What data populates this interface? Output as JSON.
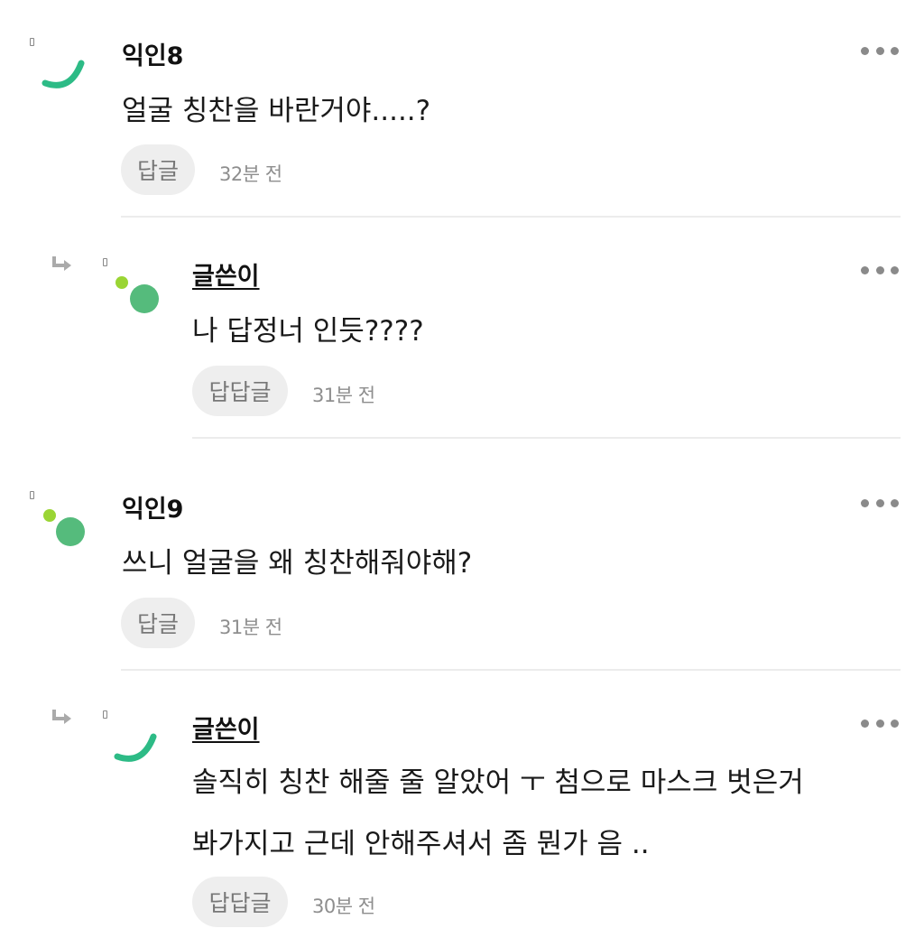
{
  "comments": [
    {
      "author": "익인8",
      "is_writer": false,
      "is_reply": false,
      "text_lines": [
        "얼굴 칭찬을 바란거야.....?"
      ],
      "reply_label": "답글",
      "time": "32분 전",
      "avatar": "green-arc",
      "more_icon": "more-dots-icon"
    },
    {
      "author": "글쓴이",
      "is_writer": true,
      "is_reply": true,
      "text_lines": [
        "나 답정너 인듯????"
      ],
      "reply_label": "답답글",
      "time": "31분 전",
      "avatar": "green-dots",
      "more_icon": "more-dots-icon"
    },
    {
      "author": "익인9",
      "is_writer": false,
      "is_reply": false,
      "text_lines": [
        "쓰니 얼굴을 왜 칭찬해줘야해?"
      ],
      "reply_label": "답글",
      "time": "31분 전",
      "avatar": "green-dots",
      "more_icon": "more-dots-icon"
    },
    {
      "author": "글쓴이",
      "is_writer": true,
      "is_reply": true,
      "text_lines": [
        "솔직히 칭찬 해줄 줄 알았어 ㅜ 첨으로 마스크 벗은거",
        "봐가지고 근데 안해주셔서 좀 뭔가 음 .."
      ],
      "reply_label": "답답글",
      "time": "30분 전",
      "avatar": "green-arc",
      "more_icon": "more-dots-icon"
    }
  ],
  "colors": {
    "avatar_green": "#2dbb86",
    "avatar_dot_green": "#55bb7c",
    "avatar_lime": "#9ad534",
    "reply_bg": "#eeeeee",
    "divider": "#ececec"
  }
}
